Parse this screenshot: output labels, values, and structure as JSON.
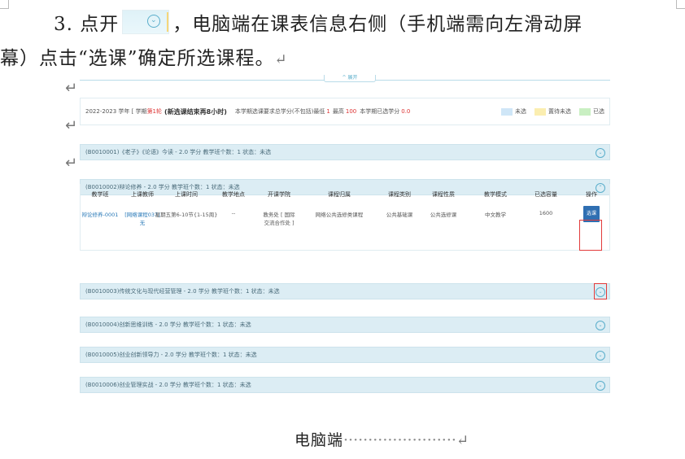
{
  "paragraph": {
    "line1_prefix": "3. 点开",
    "line1_suffix": "，电脑端在课表信息右侧（手机端需向左滑动屏",
    "line2": "幕）点击“选课”确定所选课程。",
    "return_mark": "↵",
    "inline_icon": "expand-circle-icon"
  },
  "screenshot": {
    "expand_label": "^ 展开",
    "info": {
      "year_term": "2022-2023 学年 [ 学期",
      "term_code": "第1轮",
      "rule_title": "(新选课结束再8小时)",
      "requirement": "本学期选课要求总学分(不包括)最低",
      "min_credit": "1",
      "max_label": "最高",
      "max_credit": "100",
      "selected_label": "本学期已选学分",
      "selected_credit": "0.0"
    },
    "legend": [
      {
        "label": "未选",
        "color": "#cfe6f7"
      },
      {
        "label": "置待未选",
        "color": "#fbeeb0"
      },
      {
        "label": "已选",
        "color": "#c9efc2"
      }
    ],
    "courses": [
      {
        "label": "(B0010001)《老子》《论语》今读 - 2.0 学分    教学班个数：1    状态：未选",
        "toggle": "⌄"
      },
      {
        "label": "(B0010002)辩论修养 - 2.0 学分    教学班个数：1    状态：未选",
        "toggle": "⌃"
      },
      {
        "label": "(B0010003)传统文化与现代经营管理 - 2.0 学分    教学班个数：1    状态：未选",
        "toggle": "⌄"
      },
      {
        "label": "(B0010004)创新思维训练 - 2.0 学分    教学班个数：1    状态：未选",
        "toggle": "⌄"
      },
      {
        "label": "(B0010005)创业创新领导力 - 2.0 学分    教学班个数：1    状态：未选",
        "toggle": "⌄"
      },
      {
        "label": "(B0010006)创业管理实战 - 2.0 学分    教学班个数：1    状态：未选",
        "toggle": "⌄"
      }
    ],
    "table_headers": [
      "教学班",
      "上课教师",
      "上课时间",
      "教学地点",
      "开课学院",
      "课程归属",
      "课程类别",
      "课程性质",
      "教学模式",
      "已选容量",
      "操作"
    ],
    "row": {
      "class": "辩论修养-0001",
      "teacher": "[网络课程037] 无",
      "time": "星期五第6-10节{1-15周}",
      "place": "--",
      "college": "教务处 [ 国际交流合作处 ]",
      "ownership": "网络公共选修类课程",
      "category": "公共基础课",
      "nature": "公共选修课",
      "mode": "中文教学",
      "capacity": "1600",
      "action": "选课"
    }
  },
  "caption": {
    "text": "电脑端",
    "dots": "·······················",
    "return_mark": "↵"
  }
}
